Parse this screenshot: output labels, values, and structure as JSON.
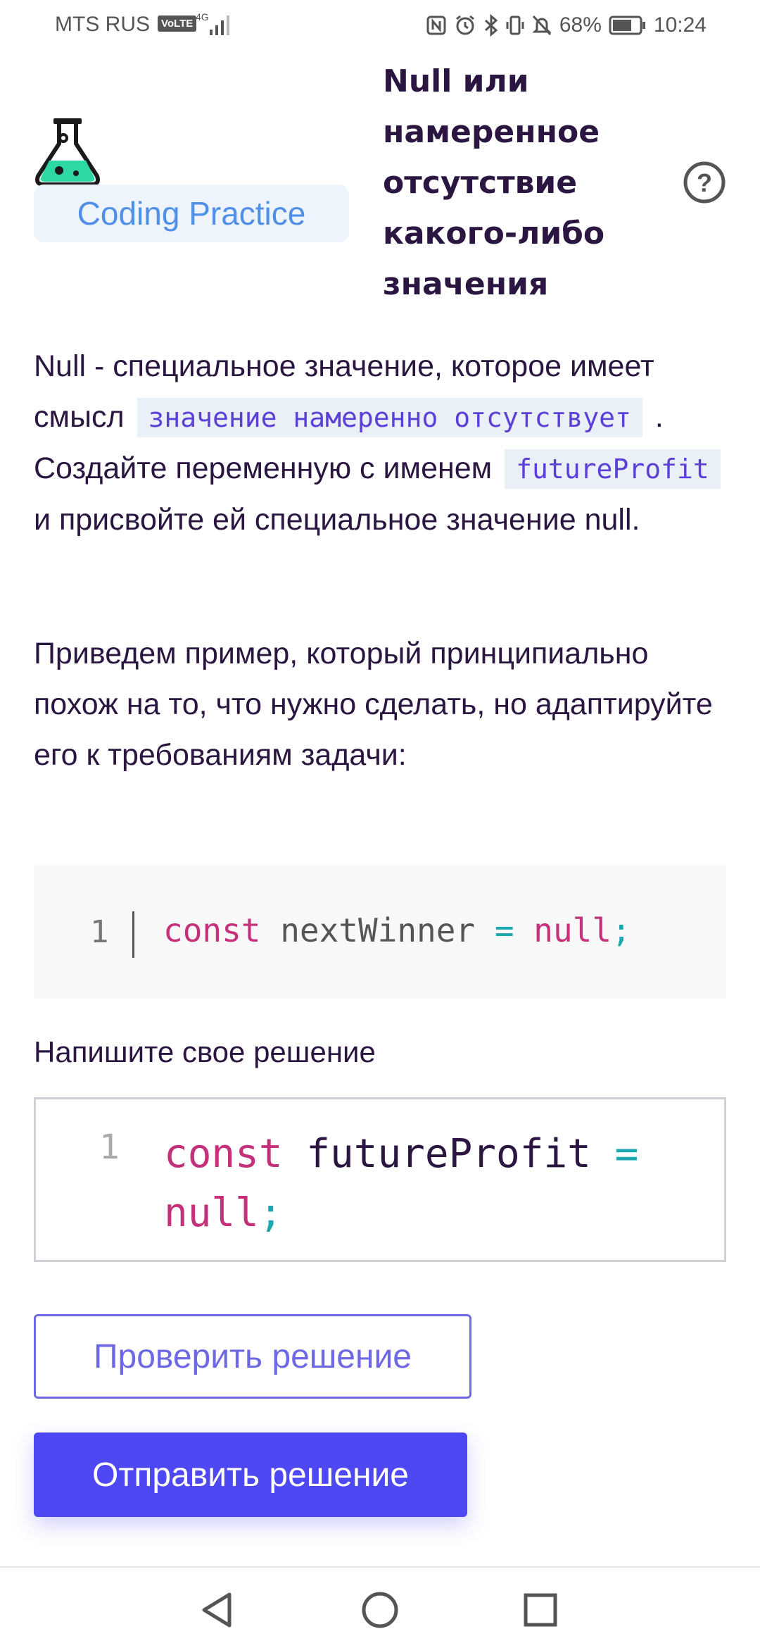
{
  "status_bar": {
    "carrier": "MTS RUS",
    "volte": "VoLTE",
    "network": "4G",
    "battery": "68%",
    "time": "10:24"
  },
  "header": {
    "badge": "Coding Practice",
    "title": "Null или намеренное отсутствие какого-либо значения",
    "icons": [
      "flask-icon",
      "help-icon"
    ]
  },
  "description": {
    "p1_part1": "Null - специальное значение, которое имеет смысл",
    "p1_code1": "значение намеренно отсутствует",
    "p1_part2": ". Создайте переменную с именем",
    "p1_code2": "futureProfit",
    "p1_part3": "и присвойте ей специальное значение null.",
    "p2": "Приведем пример, который принципиально похож на то, что нужно сделать, но адаптируйте его к требованиям задачи:"
  },
  "example": {
    "line_number": "1",
    "keyword": "const",
    "identifier": "nextWinner",
    "operator": "=",
    "value": "null",
    "terminator": ";"
  },
  "solution": {
    "label": "Напишите свое решение",
    "line_number": "1",
    "keyword": "const",
    "identifier": "futureProfit",
    "operator": "=",
    "value": "null",
    "terminator": ";"
  },
  "buttons": {
    "check": "Проверить решение",
    "submit": "Отправить решение"
  },
  "colors": {
    "accent": "#4e48f2",
    "badge_text": "#4f8fe8",
    "keyword": "#c4307a",
    "operator": "#1aa8b0",
    "text": "#2a1640"
  },
  "nav_bar": {
    "icons": [
      "back-icon",
      "home-icon",
      "recent-apps-icon"
    ]
  }
}
